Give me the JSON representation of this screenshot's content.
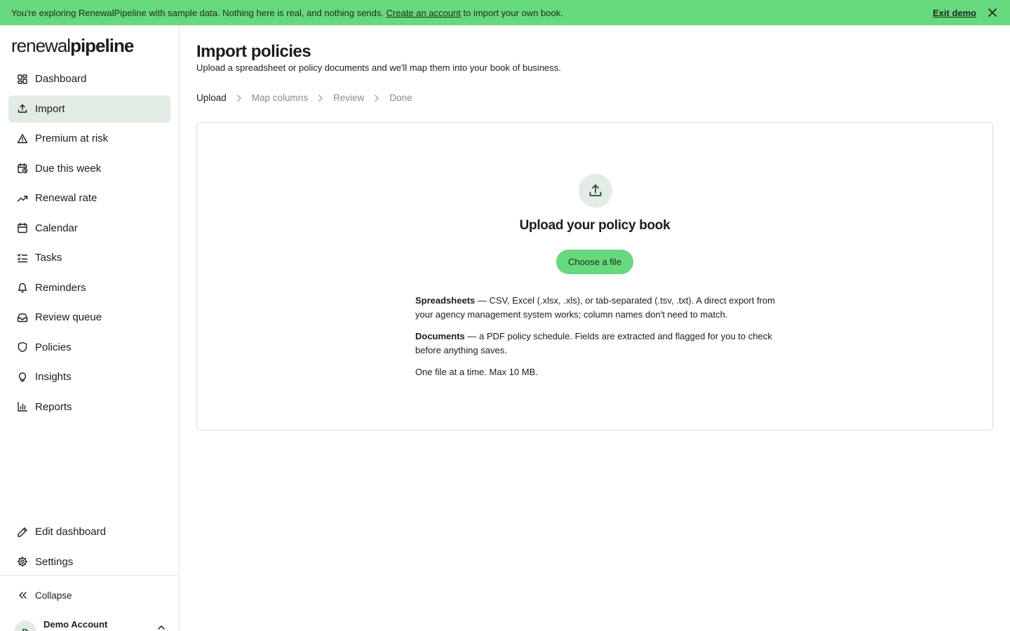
{
  "banner": {
    "message_prefix": "You're exploring RenewalPipeline with sample data. Nothing here is real, and nothing sends.",
    "link_label": "Create an account",
    "message_suffix": "to import your own book.",
    "exit_label": "Exit demo",
    "close_icon": "close-icon",
    "background": "#66d97c"
  },
  "sidebar": {
    "logo_part1": "renewal",
    "logo_part2": "pipeline",
    "items": [
      {
        "label": "Dashboard",
        "icon": "dashboard-icon",
        "active": false
      },
      {
        "label": "Import",
        "icon": "upload-icon",
        "active": true
      },
      {
        "label": "Premium at risk",
        "icon": "warning-icon",
        "active": false
      },
      {
        "label": "Due this week",
        "icon": "calendar-clock-icon",
        "active": false
      },
      {
        "label": "Renewal rate",
        "icon": "trending-up-icon",
        "active": false
      },
      {
        "label": "Calendar",
        "icon": "calendar-icon",
        "active": false
      },
      {
        "label": "Tasks",
        "icon": "list-checks-icon",
        "active": false
      },
      {
        "label": "Reminders",
        "icon": "bell-icon",
        "active": false
      },
      {
        "label": "Review queue",
        "icon": "inbox-icon",
        "active": false
      },
      {
        "label": "Policies",
        "icon": "shield-icon",
        "active": false
      },
      {
        "label": "Insights",
        "icon": "lightbulb-icon",
        "active": false
      },
      {
        "label": "Reports",
        "icon": "bar-chart-icon",
        "active": false
      }
    ],
    "bottom_items": [
      {
        "label": "Edit dashboard",
        "icon": "pencil-icon"
      },
      {
        "label": "Settings",
        "icon": "gear-icon"
      }
    ],
    "collapse_label": "Collapse",
    "account": {
      "initial": "D",
      "name": "Demo Account"
    },
    "active_bg": "#e3ece4"
  },
  "main": {
    "title": "Import policies",
    "subtitle": "Upload a spreadsheet or policy documents and we'll map them into your book of business.",
    "steps": [
      {
        "label": "Upload",
        "current": true
      },
      {
        "label": "Map columns",
        "current": false
      },
      {
        "label": "Review",
        "current": false
      },
      {
        "label": "Done",
        "current": false
      }
    ],
    "upload": {
      "title": "Upload your policy book",
      "button_label": "Choose a file",
      "spreadsheets_label": "Spreadsheets",
      "spreadsheets_text": "— CSV, Excel (.xlsx, .xls), or tab-separated (.tsv, .txt). A direct export from your agency management system works; column names don't need to match.",
      "documents_label": "Documents",
      "documents_text": "— a PDF policy schedule. Fields are extracted and flagged for you to check before anything saves.",
      "limits_text": "One file at a time. Max 10 MB."
    }
  }
}
